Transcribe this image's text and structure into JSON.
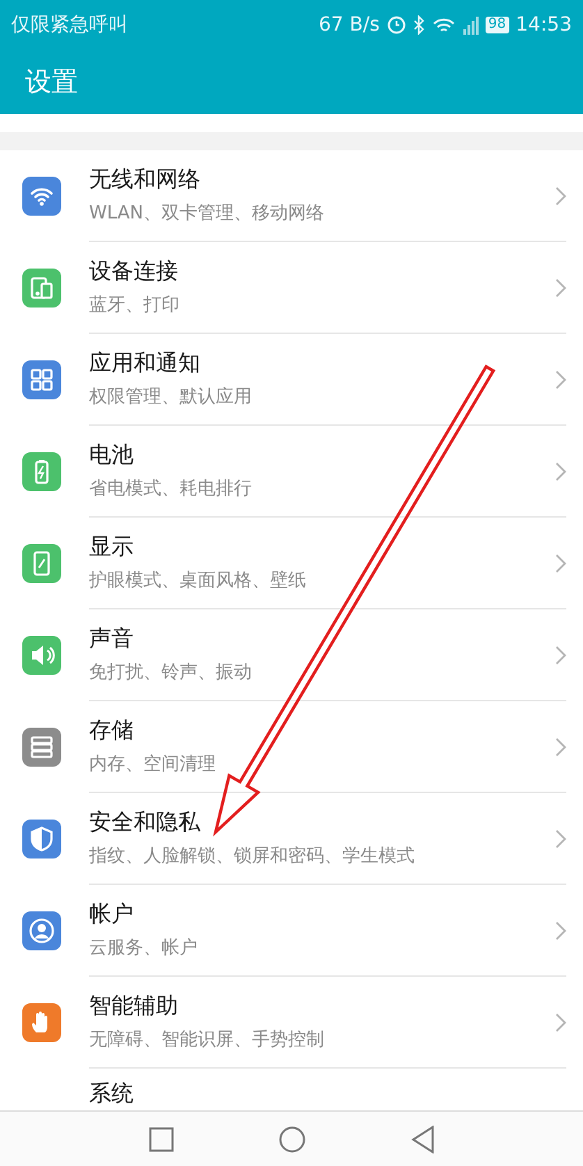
{
  "status_bar": {
    "carrier": "仅限紧急呼叫",
    "speed": "67 B/s",
    "battery": "98",
    "time": "14:53"
  },
  "app_bar": {
    "title": "设置"
  },
  "settings": [
    {
      "kind": "wifi",
      "color": "#4a86db",
      "title": "无线和网络",
      "subtitle": "WLAN、双卡管理、移动网络"
    },
    {
      "kind": "devices",
      "color": "#4cc16c",
      "title": "设备连接",
      "subtitle": "蓝牙、打印"
    },
    {
      "kind": "apps",
      "color": "#4a86db",
      "title": "应用和通知",
      "subtitle": "权限管理、默认应用"
    },
    {
      "kind": "battery",
      "color": "#4cc16c",
      "title": "电池",
      "subtitle": "省电模式、耗电排行"
    },
    {
      "kind": "display",
      "color": "#4cc16c",
      "title": "显示",
      "subtitle": "护眼模式、桌面风格、壁纸"
    },
    {
      "kind": "sound",
      "color": "#4cc16c",
      "title": "声音",
      "subtitle": "免打扰、铃声、振动"
    },
    {
      "kind": "storage",
      "color": "#8c8c8c",
      "title": "存储",
      "subtitle": "内存、空间清理"
    },
    {
      "kind": "security",
      "color": "#4a86db",
      "title": "安全和隐私",
      "subtitle": "指纹、人脸解锁、锁屏和密码、学生模式"
    },
    {
      "kind": "account",
      "color": "#4a86db",
      "title": "帐户",
      "subtitle": "云服务、帐户"
    },
    {
      "kind": "assist",
      "color": "#ef7a2a",
      "title": "智能辅助",
      "subtitle": "无障碍、智能识屏、手势控制"
    },
    {
      "kind": "none",
      "title": "系统"
    }
  ],
  "annotation": {
    "kind": "arrow",
    "color": "#e31e1e"
  }
}
